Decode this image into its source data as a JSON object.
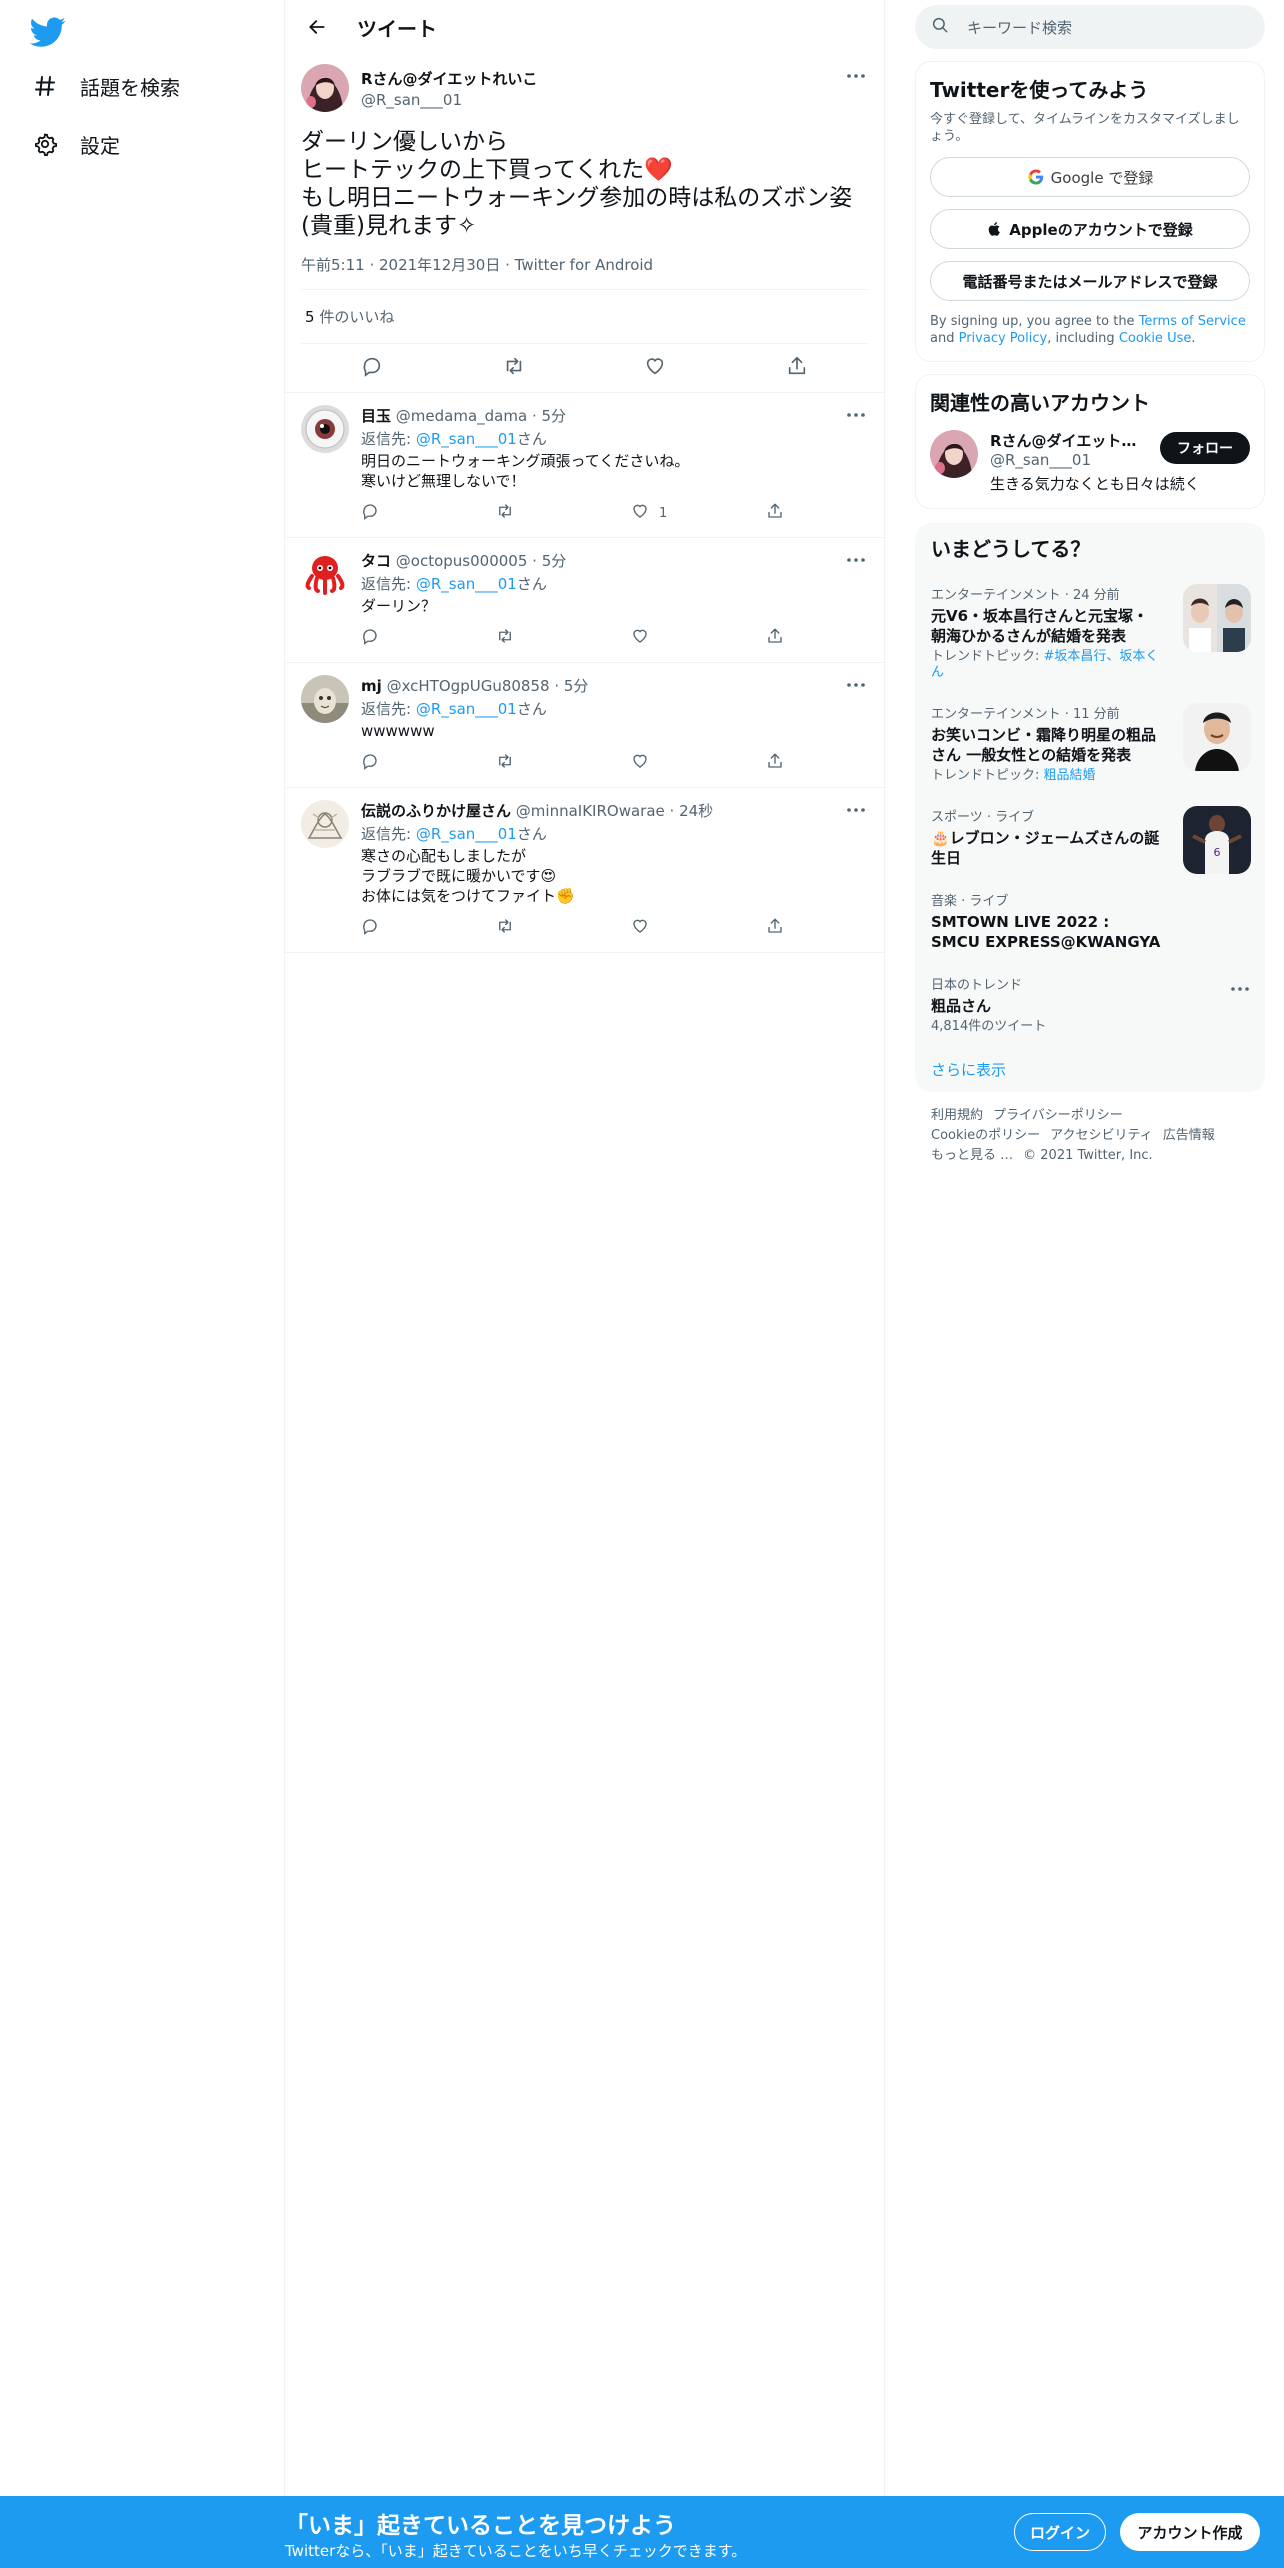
{
  "nav": {
    "items": [
      {
        "label": "話題を検索",
        "icon": "hashtag-icon"
      },
      {
        "label": "設定",
        "icon": "gear-icon"
      }
    ]
  },
  "header": {
    "title": "ツイート"
  },
  "main_tweet": {
    "name": "Rさん@ダイエットれいこ",
    "handle": "@R_san___01",
    "text": "ダーリン優しいから\nヒートテックの上下買ってくれた❤️\nもし明日ニートウォーキング参加の時は私のズボン姿(貴重)見れます✧",
    "meta": "午前5:11 · 2021年12月30日 · Twitter for Android",
    "likes_count": "5",
    "likes_label": " 件のいいね"
  },
  "replies": [
    {
      "name": "目玉",
      "handle": "@medama_dama",
      "time": "· 5分",
      "reply_prefix": "返信先: ",
      "reply_to": "@R_san___01",
      "reply_suffix": "さん",
      "text": "明日のニートウォーキング頑張ってくださいね。\n寒いけど無理しないで！",
      "like_count": "1",
      "avatar": "eyeball"
    },
    {
      "name": "タコ",
      "handle": "@octopus000005",
      "time": "· 5分",
      "reply_prefix": "返信先: ",
      "reply_to": "@R_san___01",
      "reply_suffix": "さん",
      "text": "ダーリン？",
      "like_count": "",
      "avatar": "octopus"
    },
    {
      "name": "mj",
      "handle": "@xcHTOgpUGu80858",
      "time": "· 5分",
      "reply_prefix": "返信先: ",
      "reply_to": "@R_san___01",
      "reply_suffix": "さん",
      "text": "wwwwww",
      "like_count": "",
      "avatar": "photo"
    },
    {
      "name": "伝説のふりかけ屋さん",
      "handle": "@minnaIKIROwarae",
      "time": "· 24秒",
      "reply_prefix": "返信先: ",
      "reply_to": "@R_san___01",
      "reply_suffix": "さん",
      "text": "寒さの心配もしましたが\nラブラブで既に暖かいです😍\nお体には気をつけてファイト✊",
      "like_count": "",
      "avatar": "sketch"
    }
  ],
  "search": {
    "placeholder": "キーワード検索"
  },
  "signup": {
    "title": "Twitterを使ってみよう",
    "subtitle": "今すぐ登録して、タイムラインをカスタマイズしましょう。",
    "google": "Google で登録",
    "apple": "Appleのアカウントで登録",
    "phone": "電話番号またはメールアドレスで登録",
    "legal_1": "By signing up, you agree to the ",
    "legal_tos": "Terms of Service",
    "legal_2": " and ",
    "legal_pp": "Privacy Policy",
    "legal_3": ", including ",
    "legal_cookie": "Cookie Use",
    "legal_4": "."
  },
  "related": {
    "title": "関連性の高いアカウント",
    "name": "Rさん@ダイエット…",
    "handle": "@R_san___01",
    "bio": "生きる気力なくとも日々は続く",
    "follow": "フォロー"
  },
  "trends": {
    "title": "いまどうしてる？",
    "items": [
      {
        "category": "エンターテインメント · 24 分前",
        "title": "元V6・坂本昌行さんと元宝塚・朝海ひかるさんが結婚を発表",
        "topic_prefix": "トレンドトピック: ",
        "topic": "#坂本昌行、坂本くん"
      },
      {
        "category": "エンターテインメント · 11 分前",
        "title": "お笑いコンビ・霜降り明星の粗品さん 一般女性との結婚を発表",
        "topic_prefix": "トレンドトピック: ",
        "topic": "粗品結婚"
      },
      {
        "category": "スポーツ · ライブ",
        "title": "🎂レブロン・ジェームズさんの誕生日",
        "topic_prefix": "",
        "topic": ""
      },
      {
        "category": "音楽 · ライブ",
        "title": "SMTOWN LIVE 2022 : SMCU EXPRESS@KWANGYA",
        "topic_prefix": "",
        "topic": ""
      },
      {
        "category": "日本のトレンド",
        "title": "粗品さん",
        "topic_prefix": "",
        "topic": "4,814件のツイート"
      }
    ],
    "show_more": "さらに表示"
  },
  "footer": {
    "links": [
      "利用規約",
      "プライバシーポリシー",
      "Cookieのポリシー",
      "アクセシビリティ",
      "広告情報",
      "もっと見る …",
      "© 2021 Twitter, Inc."
    ]
  },
  "bottom_bar": {
    "title": "「いま」起きていることを見つけよう",
    "subtitle": "Twitterなら、「いま」起きていることをいち早くチェックできます。",
    "login": "ログイン",
    "signup": "アカウント作成"
  },
  "colors": {
    "brand": "#1d9bf0",
    "text": "#0f1419",
    "muted": "#536471",
    "like_red": "#f4212e"
  }
}
